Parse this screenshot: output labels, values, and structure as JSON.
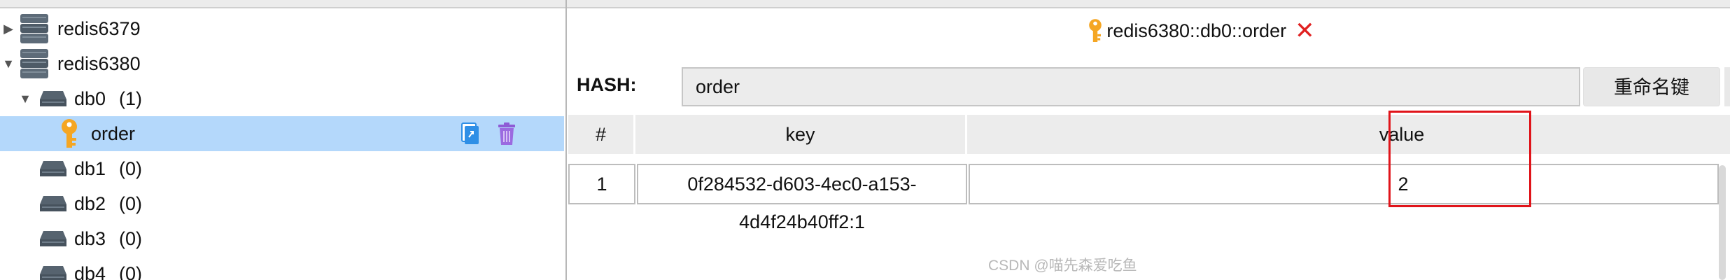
{
  "tree": {
    "servers": [
      {
        "name": "redis6379",
        "expanded": false
      },
      {
        "name": "redis6380",
        "expanded": true
      }
    ],
    "databases": [
      {
        "name": "db0",
        "count": "(1)",
        "expanded": true
      },
      {
        "name": "db1",
        "count": "(0)"
      },
      {
        "name": "db2",
        "count": "(0)"
      },
      {
        "name": "db3",
        "count": "(0)"
      },
      {
        "name": "db4",
        "count": "(0)"
      }
    ],
    "selected_key": {
      "name": "order",
      "icon": "key-icon",
      "actions": [
        "copy-icon",
        "trash-icon"
      ]
    }
  },
  "tab": {
    "title": "redis6380::db0::order",
    "icon": "key-icon",
    "close_icon": "close-icon"
  },
  "key_editor": {
    "type_label": "HASH:",
    "key_name": "order",
    "rename_label": "重命名键"
  },
  "table": {
    "columns": [
      "#",
      "key",
      "value"
    ],
    "rows": [
      {
        "index": "1",
        "key": "0f284532-d603-4ec0-a153-4d4f24b40ff2:1",
        "value": "2"
      }
    ]
  },
  "colors": {
    "selection": "#b4d8fb",
    "highlight_border": "#e0141a",
    "close": "#e02020",
    "key_icon": "#f5a623"
  },
  "watermark": "CSDN @喵先森爱吃鱼"
}
